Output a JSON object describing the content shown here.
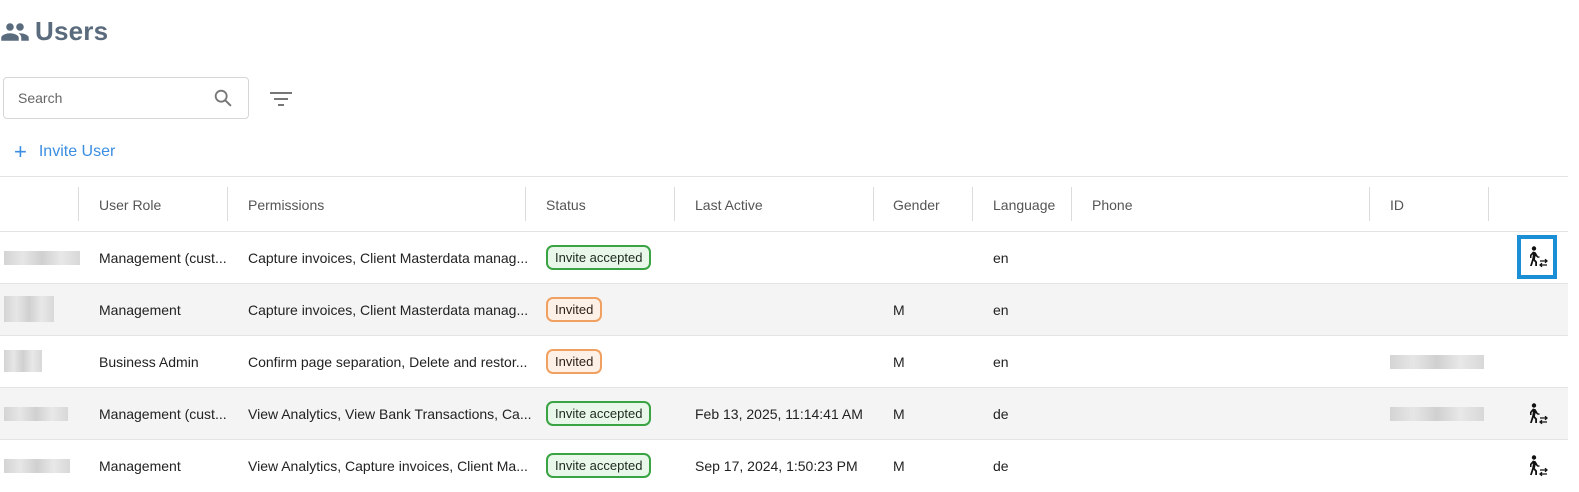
{
  "page": {
    "title": "Users",
    "title_icon": "users-icon"
  },
  "search": {
    "placeholder": "Search"
  },
  "invite": {
    "label": "Invite User"
  },
  "colors": {
    "accent": "#3b8ee0",
    "accepted": "#3aa344",
    "invited": "#f0a060",
    "focus": "#1a8fd6"
  },
  "table": {
    "columns": [
      "User Role",
      "Permissions",
      "Status",
      "Last Active",
      "Gender",
      "Language",
      "Phone",
      "ID"
    ],
    "rows": [
      {
        "role": "Management (cust...",
        "permissions": "Capture invoices, Client Masterdata manag...",
        "status": "Invite accepted",
        "last_active": "",
        "gender": "",
        "language": "en",
        "phone": "",
        "action_icon": "switch-user-icon"
      },
      {
        "role": "Management",
        "permissions": "Capture invoices, Client Masterdata manag...",
        "status": "Invited",
        "last_active": "",
        "gender": "M",
        "language": "en",
        "phone": "",
        "action_icon": ""
      },
      {
        "role": "Business Admin",
        "permissions": "Confirm page separation, Delete and restor...",
        "status": "Invited",
        "last_active": "",
        "gender": "M",
        "language": "en",
        "phone": "",
        "action_icon": ""
      },
      {
        "role": "Management (cust...",
        "permissions": "View Analytics, View Bank Transactions, Ca...",
        "status": "Invite accepted",
        "last_active": "Feb 13, 2025, 11:14:41 AM",
        "gender": "M",
        "language": "de",
        "phone": "",
        "action_icon": "switch-user-icon"
      },
      {
        "role": "Management",
        "permissions": "View Analytics, Capture invoices, Client Ma...",
        "status": "Invite accepted",
        "last_active": "Sep 17, 2024, 1:50:23 PM",
        "gender": "M",
        "language": "de",
        "phone": "",
        "action_icon": "switch-user-icon"
      }
    ]
  }
}
